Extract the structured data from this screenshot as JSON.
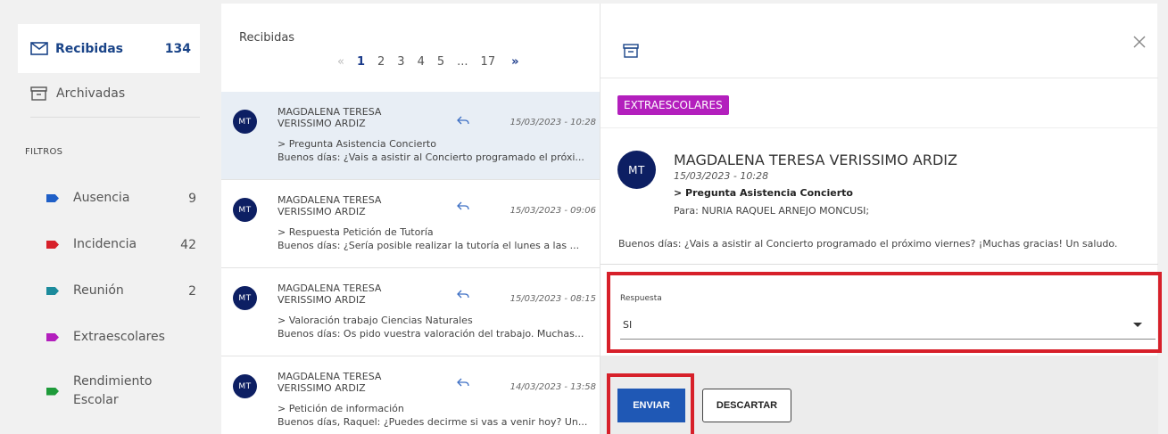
{
  "sidebar": {
    "inbox": {
      "label": "Recibidas",
      "count": "134"
    },
    "archived": {
      "label": "Archivadas"
    },
    "filters_title": "FILTROS",
    "filters": [
      {
        "label": "Ausencia",
        "count": "9",
        "color": "#1f5fc7"
      },
      {
        "label": "Incidencia",
        "count": "42",
        "color": "#d7202a"
      },
      {
        "label": "Reunión",
        "count": "2",
        "color": "#1c8b9c"
      },
      {
        "label": "Extraescolares",
        "count": "",
        "color": "#b31fbd"
      },
      {
        "label": "Rendimiento Escolar",
        "count": "",
        "color": "#1e9b3a"
      }
    ]
  },
  "list": {
    "title": "Recibidas",
    "pager": {
      "prev": "«",
      "pages": [
        "1",
        "2",
        "3",
        "4",
        "5"
      ],
      "ellipsis": "...",
      "last": "17",
      "next": "»",
      "current": "1"
    },
    "messages": [
      {
        "initials": "MT",
        "sender": "MAGDALENA TERESA VERISSIMO ARDIZ",
        "date": "15/03/2023 - 10:28",
        "subject": "> Pregunta Asistencia Concierto",
        "preview": "Buenos días: ¿Vais a asistir al Concierto programado el próxi..."
      },
      {
        "initials": "MT",
        "sender": "MAGDALENA TERESA VERISSIMO ARDIZ",
        "date": "15/03/2023 - 09:06",
        "subject": "> Respuesta Petición de Tutoría",
        "preview": "Buenos días: ¿Sería posible realizar la tutoría el lunes a las ..."
      },
      {
        "initials": "MT",
        "sender": "MAGDALENA TERESA VERISSIMO ARDIZ",
        "date": "15/03/2023 - 08:15",
        "subject": "> Valoración trabajo Ciencias Naturales",
        "preview": "Buenos días: Os pido vuestra valoración del trabajo. Muchas..."
      },
      {
        "initials": "MT",
        "sender": "MAGDALENA TERESA VERISSIMO ARDIZ",
        "date": "14/03/2023 - 13:58",
        "subject": "> Petición de información",
        "preview": "Buenos días, Raquel: ¿Puedes decirme si vas a venir hoy? Un..."
      }
    ]
  },
  "detail": {
    "category": "EXTRAESCOLARES",
    "initials": "MT",
    "sender": "MAGDALENA TERESA VERISSIMO ARDIZ",
    "date": "15/03/2023 - 10:28",
    "subject": "> Pregunta Asistencia Concierto",
    "to": "Para: NURIA RAQUEL ARNEJO MONCUSI;",
    "body": "Buenos días: ¿Vais a asistir al Concierto programado el próximo viernes? ¡Muchas gracias! Un saludo.",
    "response_label": "Respuesta",
    "response_value": "SI",
    "send_label": "ENVIAR",
    "discard_label": "DESCARTAR"
  },
  "icons": {
    "inbox": "envelope-icon",
    "archived": "archive-box-icon",
    "reply": "reply-arrow-icon",
    "close": "close-icon"
  },
  "colors": {
    "primary": "#1f58b5",
    "highlight": "#d7202a",
    "avatar": "#0d1f63"
  }
}
